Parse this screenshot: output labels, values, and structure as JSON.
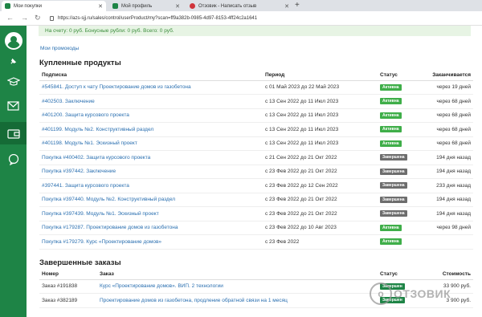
{
  "browser": {
    "tabs": [
      {
        "title": "Мои покупки",
        "favicon_color": "#1e8446"
      },
      {
        "title": "Мой профиль",
        "favicon_color": "#1e8446"
      },
      {
        "title": "Отзовик - Написать отзыв",
        "favicon_color": "#d0343b"
      }
    ],
    "url": "https://azs-sjj.ru/sales/control/userProduct/my?scan=ff9a382b-0985-4d97-8153-4ff24c2a1641"
  },
  "notice": "На счету: 0 руб.   Бонусные рубли: 0 руб.   Всего: 0 руб.",
  "promo_link": "Мои промокоды",
  "purchased": {
    "title": "Купленные продукты",
    "columns": [
      "Подписка",
      "Период",
      "Статус",
      "Заканчивается"
    ],
    "rows": [
      {
        "name": "#545841. Доступ к чату Проектирование домов из газобетона",
        "period": "с 01 Май 2023 до 22 Май 2023",
        "status": "Активна",
        "status_type": "active",
        "ends": "через 19 дней"
      },
      {
        "name": "#402503. Заключение",
        "period": "с 13 Сен 2022 до 11 Июл 2023",
        "status": "Активна",
        "status_type": "active",
        "ends": "через 68 дней"
      },
      {
        "name": "#401200. Защита курсового проекта",
        "period": "с 13 Сен 2022 до 11 Июл 2023",
        "status": "Активна",
        "status_type": "active",
        "ends": "через 68 дней"
      },
      {
        "name": "#401199. Модуль №2. Конструктивный раздел",
        "period": "с 13 Сен 2022 до 11 Июл 2023",
        "status": "Активна",
        "status_type": "active",
        "ends": "через 68 дней"
      },
      {
        "name": "#401198. Модуль №1. Эскизный проект",
        "period": "с 13 Сен 2022 до 11 Июл 2023",
        "status": "Активна",
        "status_type": "active",
        "ends": "через 68 дней"
      },
      {
        "name": "Покупка #400402. Защита курсового проекта",
        "period": "с 21 Сен 2022 до 21 Окт 2022",
        "status": "Завершена",
        "status_type": "done",
        "ends": "194 дня назад"
      },
      {
        "name": "Покупка #397442. Заключение",
        "period": "с 23 Фев 2022 до 21 Окт 2022",
        "status": "Завершена",
        "status_type": "done",
        "ends": "194 дня назад"
      },
      {
        "name": "#397441. Защита курсового проекта",
        "period": "с 23 Фев 2022 до 12 Сен 2022",
        "status": "Завершена",
        "status_type": "done",
        "ends": "233 дня назад"
      },
      {
        "name": "Покупка #397440. Модуль №2. Конструктивный раздел",
        "period": "с 23 Фев 2022 до 21 Окт 2022",
        "status": "Завершена",
        "status_type": "done",
        "ends": "194 дня назад"
      },
      {
        "name": "Покупка #397439. Модуль №1. Эскизный проект",
        "period": "с 23 Фев 2022 до 21 Окт 2022",
        "status": "Завершена",
        "status_type": "done",
        "ends": "194 дня назад"
      },
      {
        "name": "Покупка #179287. Проектирование домов из газобетона",
        "period": "с 23 Фев 2022 до 10 Авг 2023",
        "status": "Активна",
        "status_type": "active",
        "ends": "через 98 дней"
      },
      {
        "name": "Покупка #179279. Курс «Проектирование домов»",
        "period": "с 23 Фев 2022",
        "status": "Активна",
        "status_type": "active",
        "ends": ""
      }
    ]
  },
  "orders": {
    "title": "Завершенные заказы",
    "columns": [
      "Номер",
      "Заказ",
      "Статус",
      "Стоимость"
    ],
    "rows": [
      {
        "number": "Заказ #191838",
        "order": "Курс «Проектирование домов». ВИП. 2 технологии",
        "status": "Завершен",
        "cost": "33 900 руб."
      },
      {
        "number": "Заказ #382189",
        "order": "Проектирование домов из газобетона, продление обратной связи на 1 месяц",
        "status": "Завершен",
        "cost": "3 900 руб."
      }
    ]
  },
  "watermark": "ОТЗОВИК",
  "colors": {
    "brand_green": "#1e8446",
    "active_badge": "#3fae49",
    "done_badge": "#6d6d6d",
    "link": "#2a6fb0"
  }
}
